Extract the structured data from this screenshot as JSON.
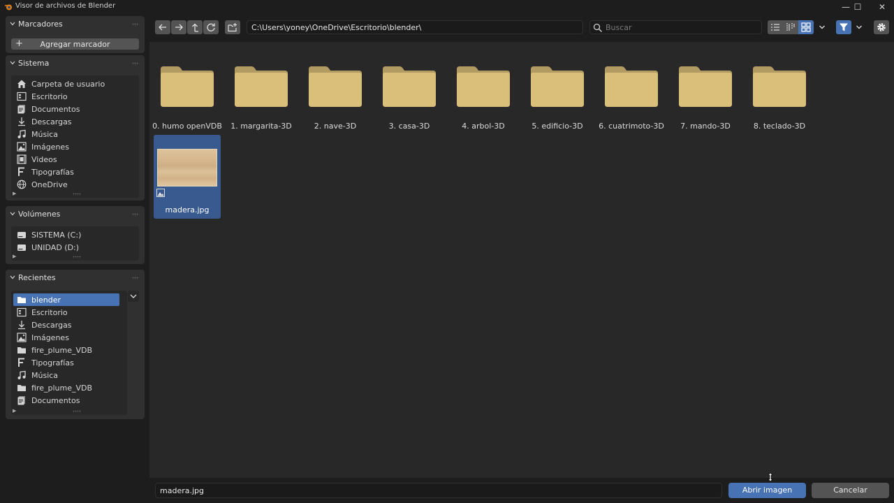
{
  "window": {
    "title": "Visor de archivos de Blender",
    "minimize": "—",
    "maximize": "☐",
    "close": "✕"
  },
  "sidebar": {
    "bookmarks": {
      "title": "Marcadores",
      "add_label": "Agregar marcador"
    },
    "system": {
      "title": "Sistema",
      "items": [
        {
          "label": "Carpeta de usuario",
          "icon": "home-icon"
        },
        {
          "label": "Escritorio",
          "icon": "desktop-icon"
        },
        {
          "label": "Documentos",
          "icon": "documents-icon"
        },
        {
          "label": "Descargas",
          "icon": "download-icon"
        },
        {
          "label": "Música",
          "icon": "music-icon"
        },
        {
          "label": "Imágenes",
          "icon": "image-icon"
        },
        {
          "label": "Videos",
          "icon": "video-icon"
        },
        {
          "label": "Tipografías",
          "icon": "font-icon"
        },
        {
          "label": "OneDrive",
          "icon": "globe-icon"
        }
      ]
    },
    "volumes": {
      "title": "Volúmenes",
      "items": [
        {
          "label": "SISTEMA (C:)",
          "icon": "drive-icon"
        },
        {
          "label": "UNIDAD (D:)",
          "icon": "drive-icon"
        }
      ]
    },
    "recent": {
      "title": "Recientes",
      "items": [
        {
          "label": "blender",
          "icon": "folder-icon",
          "selected": true
        },
        {
          "label": "Escritorio",
          "icon": "desktop-icon"
        },
        {
          "label": "Descargas",
          "icon": "download-icon"
        },
        {
          "label": "Imágenes",
          "icon": "image-icon"
        },
        {
          "label": "fire_plume_VDB",
          "icon": "folder-icon"
        },
        {
          "label": "Tipografías",
          "icon": "font-icon"
        },
        {
          "label": "Música",
          "icon": "music-icon"
        },
        {
          "label": "fire_plume_VDB",
          "icon": "folder-icon"
        },
        {
          "label": "Documentos",
          "icon": "documents-icon"
        }
      ]
    }
  },
  "toolbar": {
    "path": "C:\\Users\\yoney\\OneDrive\\Escritorio\\blender\\",
    "search_placeholder": "Buscar"
  },
  "files": [
    {
      "name": "0. humo openVDB",
      "type": "folder"
    },
    {
      "name": "1. margarita-3D",
      "type": "folder"
    },
    {
      "name": "2. nave-3D",
      "type": "folder"
    },
    {
      "name": "3. casa-3D",
      "type": "folder"
    },
    {
      "name": "4. arbol-3D",
      "type": "folder"
    },
    {
      "name": "5. edificio-3D",
      "type": "folder"
    },
    {
      "name": "6. cuatrimoto-3D",
      "type": "folder"
    },
    {
      "name": "7. mando-3D",
      "type": "folder"
    },
    {
      "name": "8. teclado-3D",
      "type": "folder"
    },
    {
      "name": "madera.jpg",
      "type": "image",
      "selected": true
    }
  ],
  "bottom": {
    "filename": "madera.jpg",
    "open_label": "Abrir imagen",
    "cancel_label": "Cancelar"
  },
  "colors": {
    "accent": "#4772b3",
    "selected_tile": "#385a8e",
    "folder": "#d9bf7a",
    "panel": "#303030"
  }
}
